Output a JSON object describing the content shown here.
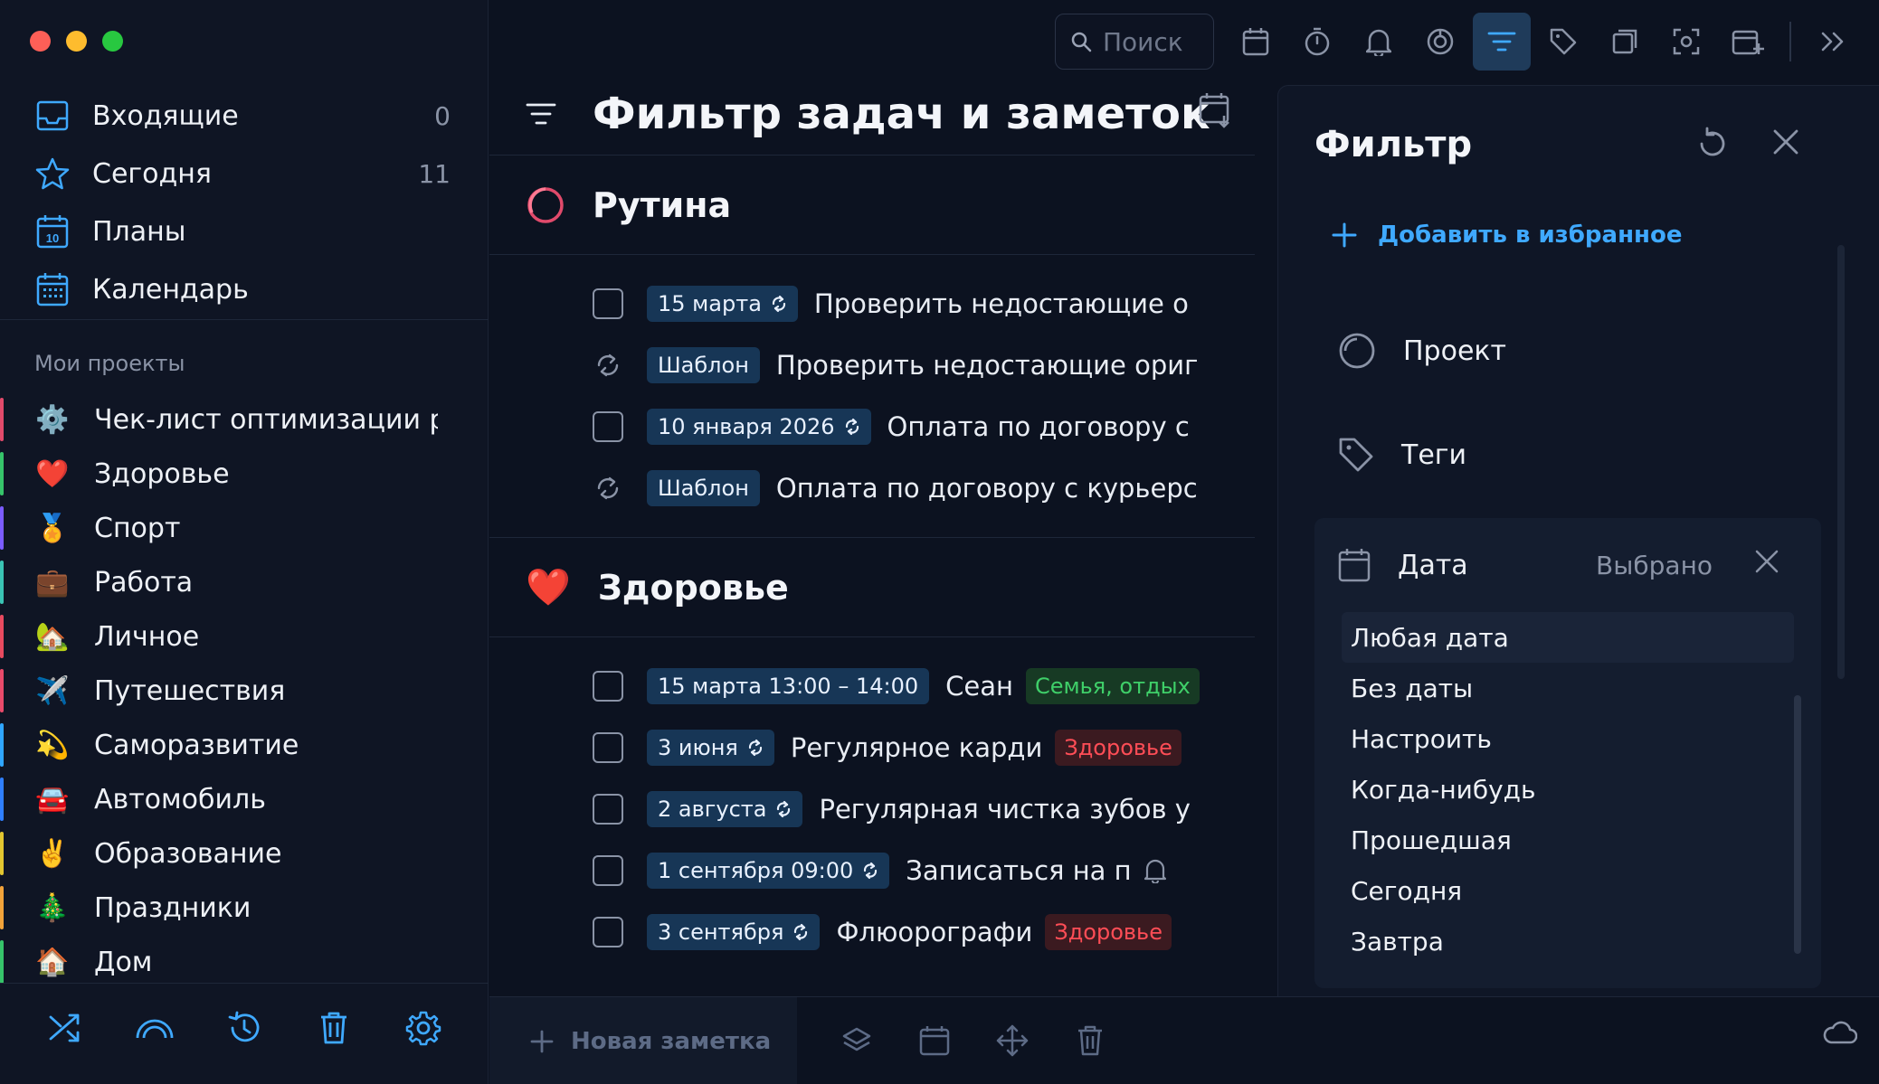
{
  "sidebar": {
    "nav": [
      {
        "label": "Входящие",
        "count": "0"
      },
      {
        "label": "Сегодня",
        "count": "11"
      },
      {
        "label": "Планы",
        "count": ""
      },
      {
        "label": "Календарь",
        "count": ""
      }
    ],
    "projects_header": "Мои проекты",
    "projects": [
      {
        "label": "Чек-лист оптимизации работы",
        "emoji": "⚙️",
        "color": "#e14a6b"
      },
      {
        "label": "Здоровье",
        "emoji": "❤️",
        "color": "#36c46a"
      },
      {
        "label": "Спорт",
        "emoji": "🏅",
        "color": "#7b5cff"
      },
      {
        "label": "Работа",
        "emoji": "💼",
        "color": "#3ac4b4"
      },
      {
        "label": "Личное",
        "emoji": "🏡",
        "color": "#e84a5f"
      },
      {
        "label": "Путешествия",
        "emoji": "✈️",
        "color": "#e84a6a"
      },
      {
        "label": "Саморазвитие",
        "emoji": "💫",
        "color": "#2fa6ff"
      },
      {
        "label": "Автомобиль",
        "emoji": "🚘",
        "color": "#2f7fff"
      },
      {
        "label": "Образование",
        "emoji": "✌️",
        "color": "#e2c630"
      },
      {
        "label": "Праздники",
        "emoji": "🎄",
        "color": "#f2a33a"
      },
      {
        "label": "Дом",
        "emoji": "🏠",
        "color": "#36c46a"
      }
    ]
  },
  "toolbar": {
    "search_placeholder": "Поиск"
  },
  "main": {
    "title": "Фильтр задач и заметок",
    "sections": [
      {
        "title": "Рутина",
        "tasks": [
          {
            "kind": "checkbox",
            "chip": "15 марта",
            "repeat": true,
            "text": "Проверить недостающие о",
            "tag": null
          },
          {
            "kind": "template",
            "chip": "Шаблон",
            "repeat": false,
            "text": "Проверить недостающие ориг",
            "tag": null
          },
          {
            "kind": "checkbox",
            "chip": "10 января 2026",
            "repeat": true,
            "text": "Оплата по договору с",
            "tag": null
          },
          {
            "kind": "template",
            "chip": "Шаблон",
            "repeat": false,
            "text": "Оплата по договору с курьерс",
            "tag": null
          }
        ]
      },
      {
        "title": "Здоровье",
        "tasks": [
          {
            "kind": "checkbox",
            "chip": "15 марта 13:00 – 14:00",
            "repeat": false,
            "text": "Сеан",
            "tag": {
              "label": "Семья, отдых",
              "style": "green"
            }
          },
          {
            "kind": "checkbox",
            "chip": "3 июня",
            "repeat": true,
            "text": "Регулярное карди",
            "tag": {
              "label": "Здоровье",
              "style": "red"
            }
          },
          {
            "kind": "checkbox",
            "chip": "2 августа",
            "repeat": true,
            "text": "Регулярная чистка зубов у",
            "tag": null
          },
          {
            "kind": "checkbox",
            "chip": "1 сентября 09:00",
            "repeat": true,
            "text": "Записаться на п",
            "tag": null,
            "bell": true
          },
          {
            "kind": "checkbox",
            "chip": "3 сентября",
            "repeat": true,
            "text": "Флюорографи",
            "tag": {
              "label": "Здоровье",
              "style": "red"
            }
          }
        ]
      }
    ]
  },
  "bottombar": {
    "new_note": "Новая заметка"
  },
  "filter": {
    "title": "Фильтр",
    "add_favorite": "Добавить в избранное",
    "project_label": "Проект",
    "tags_label": "Теги",
    "date_label": "Дата",
    "date_selected": "Выбрано",
    "date_options": [
      "Любая дата",
      "Без даты",
      "Настроить",
      "Когда-нибудь",
      "Прошедшая",
      "Сегодня",
      "Завтра"
    ],
    "highlighted_option": "Любая дата"
  },
  "colors": {
    "accent": "#3fa9ff",
    "chip_bg": "#173656",
    "tag_green": "#3fcf69",
    "tag_red": "#ff4d56"
  }
}
